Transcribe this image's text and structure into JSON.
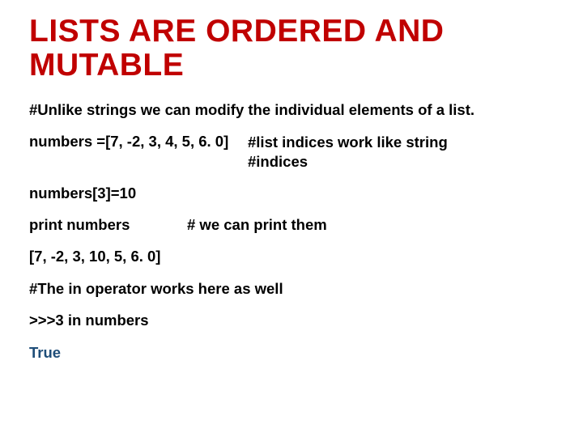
{
  "title": "LISTS ARE  ORDERED AND MUTABLE",
  "intro": "#Unlike strings we can modify the individual elements of a list.",
  "assign_line": "numbers =[7, -2, 3, 4, 5, 6. 0]",
  "assign_comment_l1": "#list indices work like string",
  "assign_comment_l2": "#indices",
  "mutate_line": "numbers[3]=10",
  "print_line": "print numbers",
  "print_comment": "# we can print them",
  "output_list": "[7, -2, 3, 10, 5, 6. 0]",
  "in_comment": "#The in operator works here as well",
  "in_line": ">>>3 in numbers",
  "result": "True"
}
